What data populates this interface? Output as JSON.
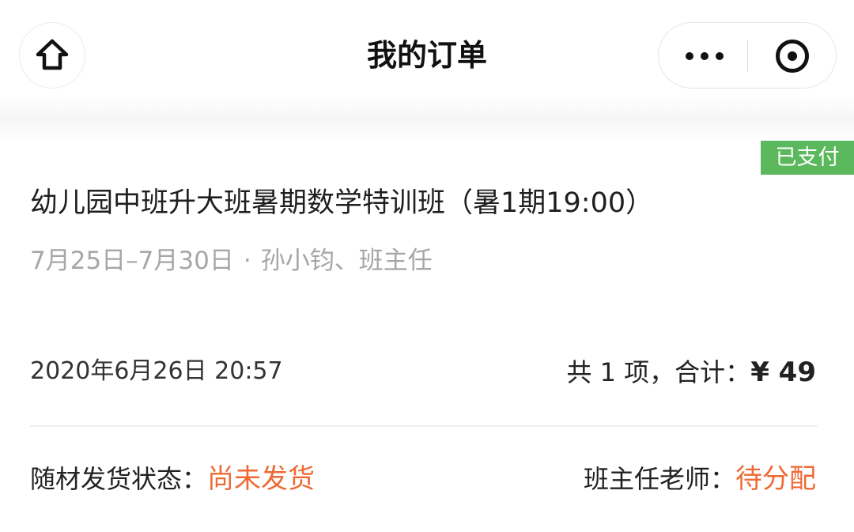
{
  "nav": {
    "title": "我的订单",
    "home_icon": "home-icon",
    "more_icon": "more-dots-icon",
    "close_icon": "mini-program-close-icon"
  },
  "order": {
    "status_badge": "已支付",
    "course_title": "幼儿园中班升大班暑期数学特训班（暑1期19:00）",
    "date_range": "7月25日–7月30日",
    "separator": "·",
    "teachers": "孙小钧、班主任",
    "order_time": "2020年6月26日 20:57",
    "total_prefix": "共 1 项，合计：",
    "total_amount": "¥ 49",
    "shipping_label": "随材发货状态：",
    "shipping_value": "尚未发货",
    "teacher_label": "班主任老师：",
    "teacher_value": "待分配"
  },
  "colors": {
    "badge_green": "#5cb85c",
    "accent_orange": "#ee6a35",
    "subtext_gray": "#a6a6a6"
  }
}
